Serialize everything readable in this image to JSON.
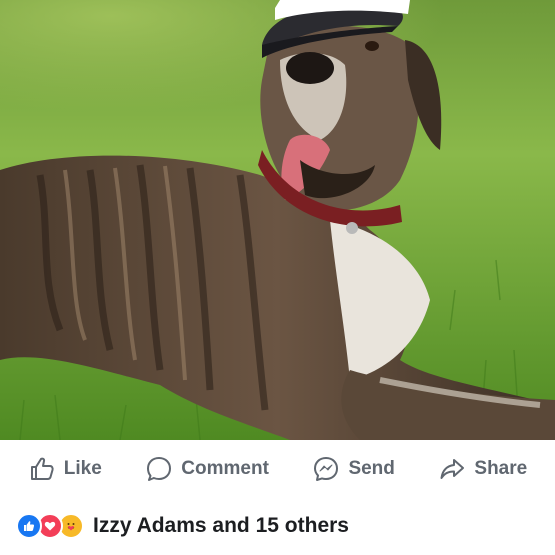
{
  "actions": {
    "like": "Like",
    "comment": "Comment",
    "send": "Send",
    "share": "Share"
  },
  "reactions": {
    "summary": "Izzy Adams and 15 others",
    "types": [
      "like-icon",
      "love-icon",
      "care-icon"
    ]
  },
  "colors": {
    "action_gray": "#606770",
    "like_blue": "#1877f2",
    "love_red": "#f33e58",
    "care_yellow": "#f7b928",
    "text_dark": "#1c1e21"
  }
}
